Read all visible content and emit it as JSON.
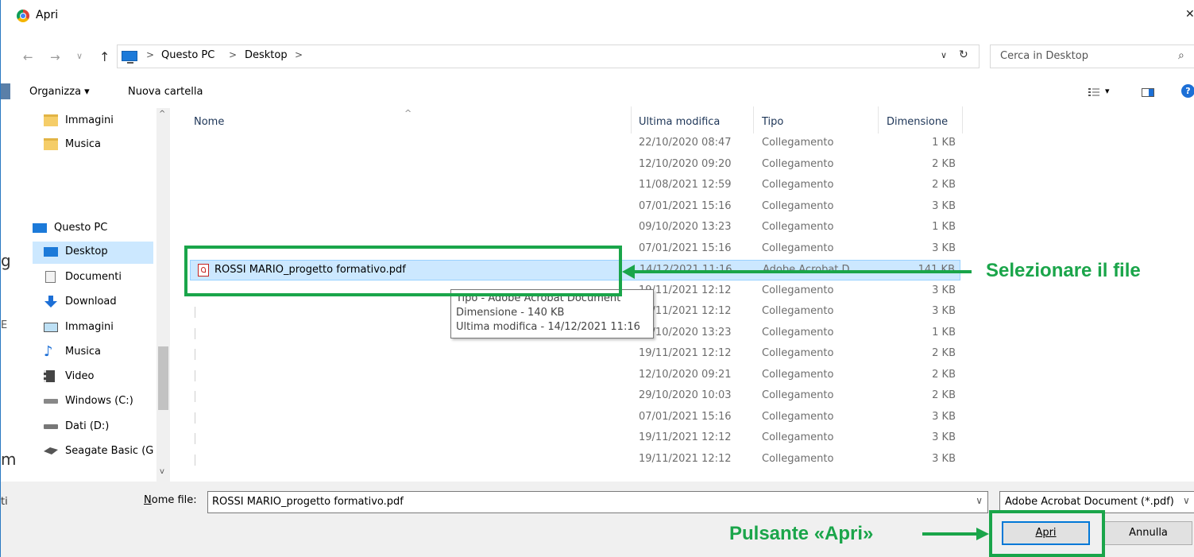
{
  "window": {
    "title": "Apri",
    "close": "✕"
  },
  "nav": {
    "back": "←",
    "forward": "→",
    "recent": "∨",
    "up": "↑"
  },
  "address": {
    "crumbs": [
      "Questo PC",
      "Desktop"
    ],
    "separator": ">",
    "dropdown": "∨",
    "refresh": "↻"
  },
  "search": {
    "placeholder": "Cerca in Desktop",
    "icon": "search-icon"
  },
  "toolbar": {
    "organize": "Organizza ▾",
    "new_folder": "Nuova cartella",
    "view_icon": "view-options-icon",
    "view_dd": "▾",
    "preview_icon": "preview-pane-icon",
    "help": "?"
  },
  "sidebar": {
    "items": [
      {
        "label": "Immagini",
        "icon": "folder-icon"
      },
      {
        "label": "Musica",
        "icon": "folder-icon"
      },
      {
        "label": "Questo PC",
        "icon": "computer-icon"
      },
      {
        "label": "Desktop",
        "icon": "desktop-icon",
        "selected": true
      },
      {
        "label": "Documenti",
        "icon": "documents-icon"
      },
      {
        "label": "Download",
        "icon": "download-icon"
      },
      {
        "label": "Immagini",
        "icon": "pictures-icon"
      },
      {
        "label": "Musica",
        "icon": "music-icon"
      },
      {
        "label": "Video",
        "icon": "video-icon"
      },
      {
        "label": "Windows (C:)",
        "icon": "drive-icon"
      },
      {
        "label": "Dati (D:)",
        "icon": "drive-icon"
      },
      {
        "label": "Seagate Basic (G",
        "icon": "external-drive-icon"
      }
    ],
    "scroll_up": "^",
    "scroll_down": "v"
  },
  "columns": {
    "name": "Nome",
    "modified": "Ultima modifica",
    "type": "Tipo",
    "size": "Dimensione",
    "sort_indicator": "^"
  },
  "files": [
    {
      "name": "",
      "modified": "22/10/2020 08:47",
      "type": "Collegamento",
      "size": "1 KB"
    },
    {
      "name": "",
      "modified": "12/10/2020 09:20",
      "type": "Collegamento",
      "size": "2 KB"
    },
    {
      "name": "",
      "modified": "11/08/2021 12:59",
      "type": "Collegamento",
      "size": "2 KB"
    },
    {
      "name": "",
      "modified": "07/01/2021 15:16",
      "type": "Collegamento",
      "size": "3 KB"
    },
    {
      "name": "",
      "modified": "09/10/2020 13:23",
      "type": "Collegamento",
      "size": "1 KB"
    },
    {
      "name": "",
      "modified": "07/01/2021 15:16",
      "type": "Collegamento",
      "size": "3 KB"
    },
    {
      "name": "ROSSI MARIO_progetto formativo.pdf",
      "modified": "14/12/2021 11:16",
      "type": "Adobe Acrobat D...",
      "size": "141 KB",
      "selected": true
    },
    {
      "name": "",
      "modified": "19/11/2021 12:12",
      "type": "Collegamento",
      "size": "3 KB"
    },
    {
      "name": "",
      "modified": "19/11/2021 12:12",
      "type": "Collegamento",
      "size": "3 KB"
    },
    {
      "name": "",
      "modified": "15/10/2020 13:23",
      "type": "Collegamento",
      "size": "1 KB"
    },
    {
      "name": "",
      "modified": "19/11/2021 12:12",
      "type": "Collegamento",
      "size": "2 KB"
    },
    {
      "name": "",
      "modified": "12/10/2020 09:21",
      "type": "Collegamento",
      "size": "2 KB"
    },
    {
      "name": "",
      "modified": "29/10/2020 10:03",
      "type": "Collegamento",
      "size": "2 KB"
    },
    {
      "name": "",
      "modified": "07/01/2021 15:16",
      "type": "Collegamento",
      "size": "3 KB"
    },
    {
      "name": "",
      "modified": "19/11/2021 12:12",
      "type": "Collegamento",
      "size": "3 KB"
    },
    {
      "name": "",
      "modified": "19/11/2021 12:12",
      "type": "Collegamento",
      "size": "3 KB"
    }
  ],
  "tooltip": {
    "line1": "Tipo - Adobe Acrobat Document",
    "line2": "Dimensione - 140 KB",
    "line3": "Ultima modifica - 14/12/2021 11:16"
  },
  "footer": {
    "filename_label": "Nome file:",
    "filename_value": "ROSSI MARIO_progetto formativo.pdf",
    "filter_value": "Adobe Acrobat Document (*.pdf)",
    "dropdown": "∨",
    "open_button": "Apri",
    "cancel_button": "Annulla"
  },
  "annotations": {
    "select_file": "Selezionare il file",
    "open_button": "Pulsante «Apri»",
    "color": "#1aa54a"
  },
  "background_fragments": [
    "g",
    "E",
    "m",
    "ti"
  ]
}
